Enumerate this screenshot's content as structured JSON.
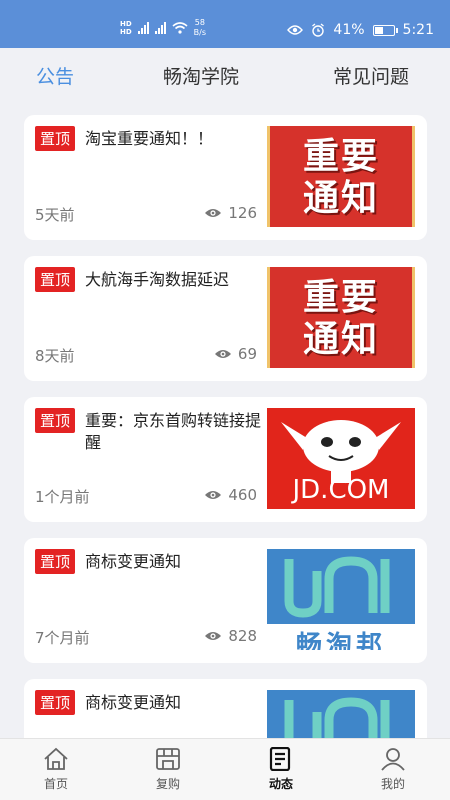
{
  "status_bar": {
    "hd_top": "HD",
    "hd_bottom": "HD",
    "net_speed_value": "58",
    "net_speed_unit": "B/s",
    "battery": "41%",
    "time": "5:21"
  },
  "tabs": [
    {
      "label": "公告",
      "active": true
    },
    {
      "label": "畅淘学院",
      "active": false
    },
    {
      "label": "常见问题",
      "active": false
    }
  ],
  "cards": [
    {
      "pin": "置顶",
      "title": "淘宝重要通知！！",
      "time": "5天前",
      "views": "126",
      "thumb": "notice",
      "thumb_lines": [
        "重要",
        "通知"
      ]
    },
    {
      "pin": "置顶",
      "title": "大航海手淘数据延迟",
      "time": "8天前",
      "views": "69",
      "thumb": "notice",
      "thumb_lines": [
        "重要",
        "通知"
      ]
    },
    {
      "pin": "置顶",
      "title": "重要：京东首购转链接提醒",
      "time": "1个月前",
      "views": "460",
      "thumb": "jd",
      "thumb_text": "JD.COM"
    },
    {
      "pin": "置顶",
      "title": "商标变更通知",
      "time": "7个月前",
      "views": "828",
      "thumb": "logo",
      "thumb_text": "畅淘邦"
    },
    {
      "pin": "置顶",
      "title": "商标变更通知",
      "time": "",
      "views": "",
      "thumb": "logo",
      "thumb_text": ""
    }
  ],
  "bottom_nav": [
    {
      "label": "首页",
      "icon": "home-icon",
      "active": false
    },
    {
      "label": "复购",
      "icon": "store-icon",
      "active": false
    },
    {
      "label": "动态",
      "icon": "document-icon",
      "active": true
    },
    {
      "label": "我的",
      "icon": "person-icon",
      "active": false
    }
  ],
  "colors": {
    "accent": "#4a8fe0",
    "status_bar": "#5b8fd8",
    "pin": "#e32323"
  }
}
